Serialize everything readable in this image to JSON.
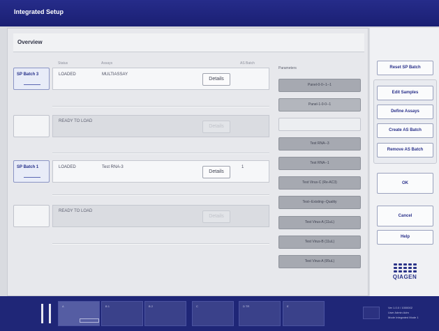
{
  "window": {
    "title": "Integrated Setup"
  },
  "overview": {
    "title": "Overview"
  },
  "columns": {
    "status": "Status",
    "assays": "Assays",
    "as_batch": "AS Batch",
    "parameters": "Parameters"
  },
  "rows": [
    {
      "slot_label": "SP Batch 3",
      "status": "LOADED",
      "assay": "MULTIASSAY",
      "as_batch": "",
      "details_label": "Details"
    },
    {
      "slot_label": "",
      "status": "READY TO LOAD",
      "assay": "",
      "as_batch": "",
      "details_label": "Details"
    },
    {
      "slot_label": "SP Batch 1",
      "status": "LOADED",
      "assay": "Test RNA-3",
      "as_batch": "1",
      "details_label": "Details"
    },
    {
      "slot_label": "",
      "status": "READY TO LOAD",
      "assay": "",
      "as_batch": "",
      "details_label": "Details"
    }
  ],
  "parameters": [
    "Panel-0-0--1--1",
    "Panel-1-0-0--1",
    "",
    "Test RNA--3",
    "Test RNA--1",
    "Test Virus-C (Re-AC3)",
    "Test--Existing--Quality",
    "Test Virus-A (11uL)",
    "Test Virus-B (11uL)",
    "Test Virus-A (95uL)"
  ],
  "actions": {
    "reset": "Reset SP Batch",
    "edit_samples": "Edit Samples",
    "define_assays": "Define Assays",
    "create_as_batch": "Create AS Batch",
    "remove_as_batch": "Remove AS Batch",
    "ok": "OK",
    "cancel": "Cancel",
    "help": "Help"
  },
  "brand": {
    "logo_text": "QIAGEN",
    "color": "#2a3388"
  },
  "taskbar": {
    "slots": [
      "A",
      "B 1",
      "B 2",
      "C",
      "D TR",
      "E"
    ],
    "info": [
      "Ver 1.0.0 / 1000002",
      "User      Admin Adm",
      "Mode      Integrated Mode 1"
    ]
  }
}
